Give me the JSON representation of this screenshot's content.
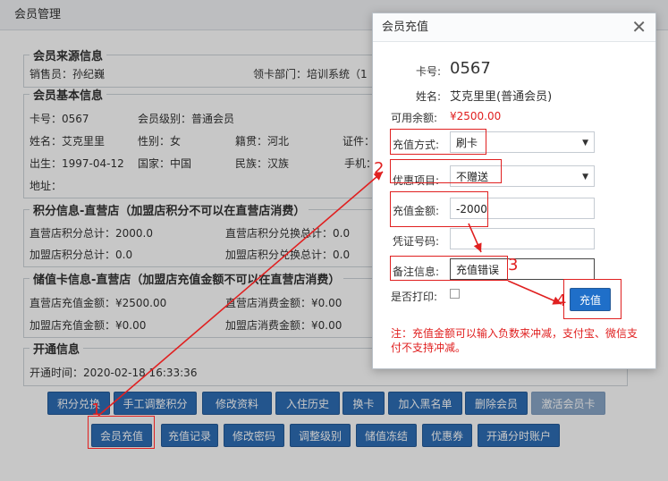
{
  "window": {
    "title": "会员管理"
  },
  "source_info": {
    "legend": "会员来源信息",
    "seller": "销售员：孙纪巍",
    "department": "领卡部门：培训系统（1"
  },
  "basic_info": {
    "legend": "会员基本信息",
    "card_no": "卡号：0567",
    "level": "会员级别：普通会员",
    "name": "姓名：艾克里里",
    "gender": "性别：女",
    "native": "籍贯：河北",
    "id_card": "证件：",
    "birth": "出生：1997-04-12",
    "country": "国家：中国",
    "ethnic": "民族：汉族",
    "phone": "手机：",
    "address": "地址："
  },
  "points_info": {
    "legend": "积分信息-直营店（加盟店积分不可以在直营店消费）",
    "direct_total": "直营店积分总计：2000.0",
    "direct_exchange": "直营店积分兑换总计：0.0",
    "franchise_total": "加盟店积分总计：0.0",
    "franchise_exchange": "加盟店积分兑换总计：0.0"
  },
  "stored_info": {
    "legend": "储值卡信息-直营店（加盟店充值金额不可以在直营店消费）",
    "direct_recharge": "直营店充值金额：¥2500.00",
    "direct_consume": "直营店消费金额：¥0.00",
    "franchise_recharge": "加盟店充值金额：¥0.00",
    "franchise_consume": "加盟店消费金额：¥0.00"
  },
  "open_info": {
    "legend": "开通信息",
    "open_time": "开通时间：2020-02-18 16:33:36"
  },
  "buttons_row1": [
    "积分兑换",
    "手工调整积分",
    "修改资料",
    "入住历史",
    "换卡",
    "加入黑名单",
    "删除会员",
    "激活会员卡"
  ],
  "buttons_row2": [
    "会员充值",
    "充值记录",
    "修改密码",
    "调整级别",
    "储值冻结",
    "优惠券",
    "开通分时账户"
  ],
  "dialog": {
    "title": "会员充值",
    "close_icon": "close-icon",
    "card_label": "卡号:",
    "card_value": "0567",
    "name_label": "姓名:",
    "name_value": "艾克里里(普通会员)",
    "balance_label": "可用余额:",
    "balance_value": "¥2500.00",
    "method_label": "充值方式:",
    "method_value": "刷卡",
    "promo_label": "优惠项目:",
    "promo_value": "不赠送",
    "amount_label": "充值金额:",
    "amount_value": "-2000",
    "voucher_label": "凭证号码:",
    "voucher_value": "",
    "remark_label": "备注信息:",
    "remark_value": "充值错误",
    "print_label": "是否打印:",
    "submit_label": "充值",
    "note": "注：充值金额可以输入负数来冲减，支付宝、微信支付不支持冲减。"
  },
  "annotations": [
    "1",
    "2",
    "3",
    "4"
  ],
  "colors": {
    "button_blue": "#2e6db5",
    "annotation_red": "#e02020",
    "balance_red": "#e02020",
    "note_red": "#e02020"
  }
}
